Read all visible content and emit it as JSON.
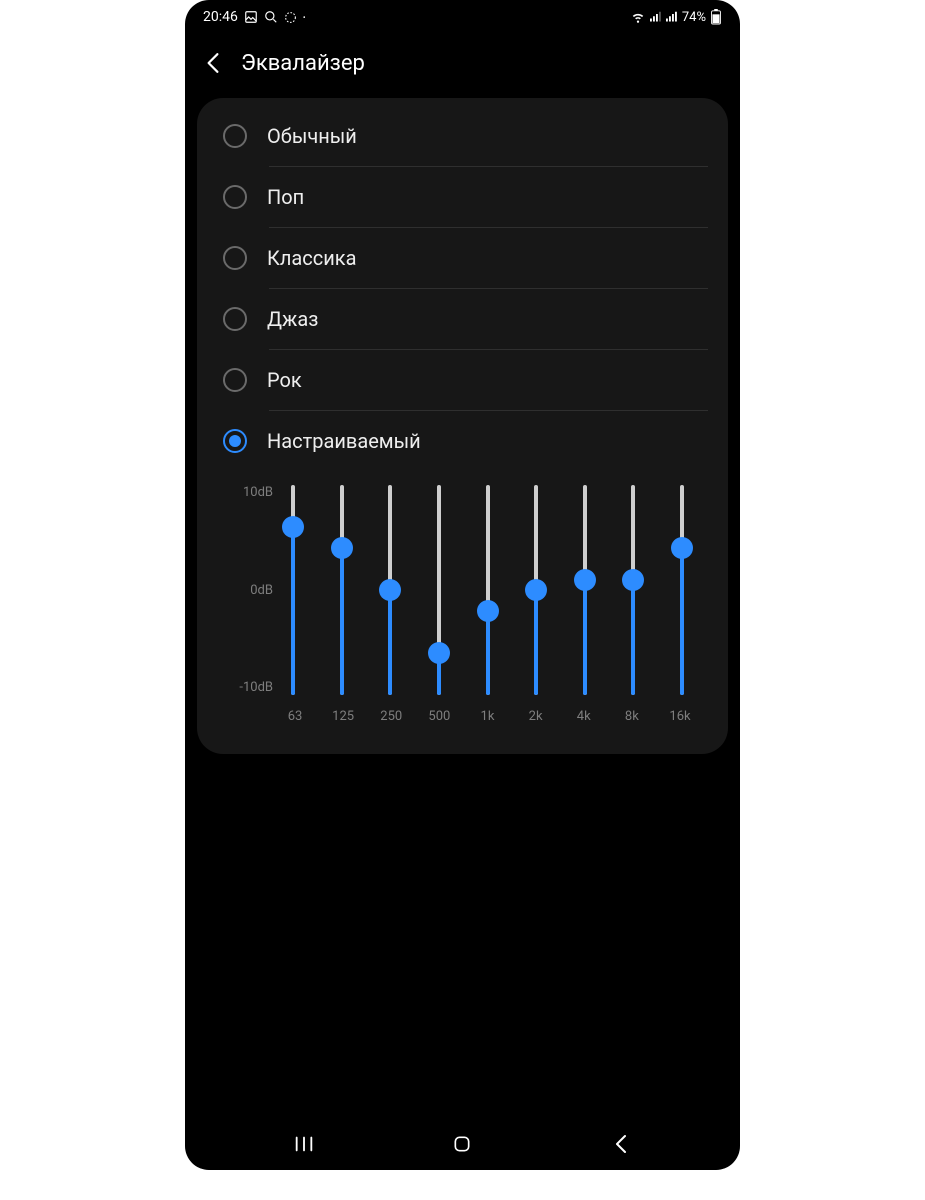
{
  "status": {
    "time": "20:46",
    "battery_text": "74%"
  },
  "header": {
    "title": "Эквалайзер"
  },
  "options": [
    {
      "label": "Обычный",
      "selected": false
    },
    {
      "label": "Поп",
      "selected": false
    },
    {
      "label": "Классика",
      "selected": false
    },
    {
      "label": "Джаз",
      "selected": false
    },
    {
      "label": "Рок",
      "selected": false
    },
    {
      "label": "Настраиваемый",
      "selected": true
    }
  ],
  "chart_data": {
    "type": "bar",
    "title": "",
    "ylabel": "",
    "xlabel": "",
    "y_ticks": [
      "10dB",
      "0dB",
      "-10dB"
    ],
    "ylim": [
      -10,
      10
    ],
    "categories": [
      "63",
      "125",
      "250",
      "500",
      "1k",
      "2k",
      "4k",
      "8k",
      "16k"
    ],
    "values": [
      6,
      4,
      0,
      -6,
      -2,
      0,
      1,
      1,
      4
    ]
  },
  "colors": {
    "accent": "#2d8cff",
    "card_bg": "#171717"
  }
}
